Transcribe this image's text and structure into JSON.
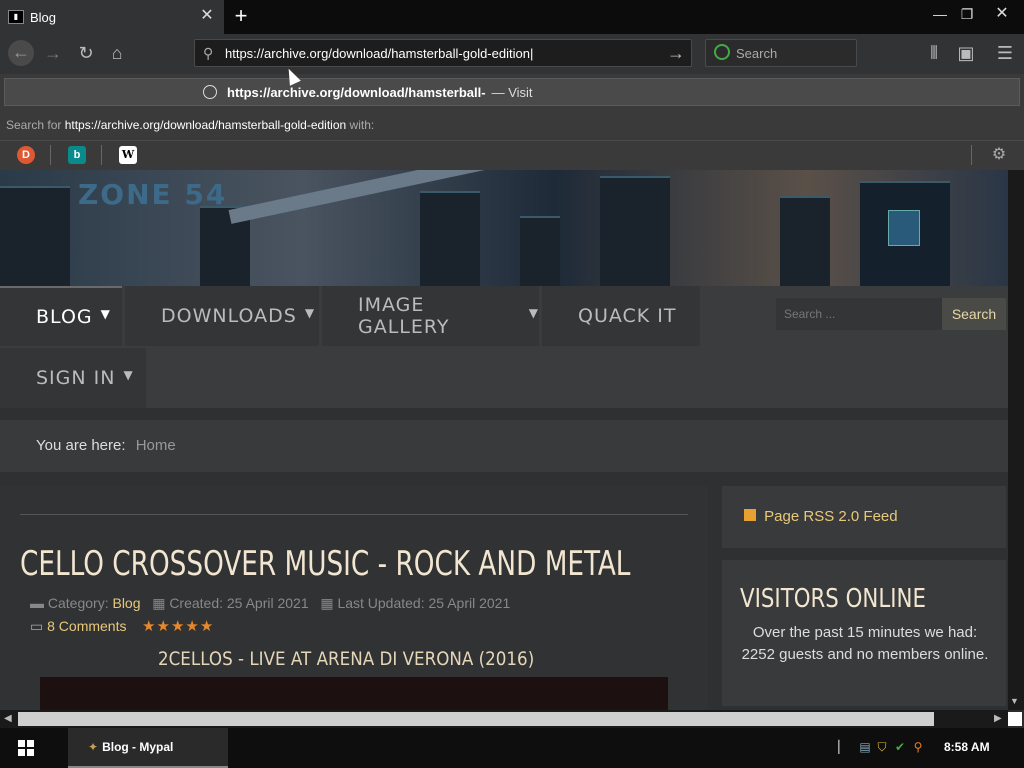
{
  "browser": {
    "tab_title": "Blog",
    "url": "https://archive.org/download/hamsterball-gold-edition",
    "search_placeholder": "Search",
    "suggestion_url": "https://archive.org/download/hamsterball-",
    "suggestion_action": "— Visit",
    "search_for_prefix": "Search for",
    "search_for_query": "https://archive.org/download/hamsterball-gold-edition",
    "search_for_suffix": "with:"
  },
  "site": {
    "logo": "ZONE 54",
    "menu": [
      {
        "label": "BLOG",
        "has_caret": true
      },
      {
        "label": "DOWNLOADS",
        "has_caret": true
      },
      {
        "label": "IMAGE GALLERY",
        "has_caret": true
      },
      {
        "label": "QUACK IT",
        "has_caret": false
      },
      {
        "label": "SIGN IN",
        "has_caret": true
      }
    ],
    "search_placeholder": "Search ...",
    "search_button": "Search",
    "breadcrumb_label": "You are here:",
    "breadcrumb_home": "Home"
  },
  "article": {
    "title": "CELLO CROSSOVER MUSIC - ROCK AND METAL",
    "category_label": "Category:",
    "category": "Blog",
    "created": "Created: 25 April 2021",
    "updated": "Last Updated: 25 April 2021",
    "comments": "8 Comments",
    "rating_stars": 5,
    "subtitle": "2CELLOS - LIVE AT ARENA DI VERONA (2016)"
  },
  "sidebar": {
    "rss": "Page RSS 2.0 Feed",
    "visitors_title": "VISITORS ONLINE",
    "visitors_text": "Over the past 15 minutes we had: 2252 guests and no members online."
  },
  "taskbar": {
    "app": "Blog - Mypal",
    "time": "8:58 AM"
  },
  "colors": {
    "accent": "#e8c97a",
    "heading": "#f2e6d0",
    "star": "#e8882a"
  }
}
